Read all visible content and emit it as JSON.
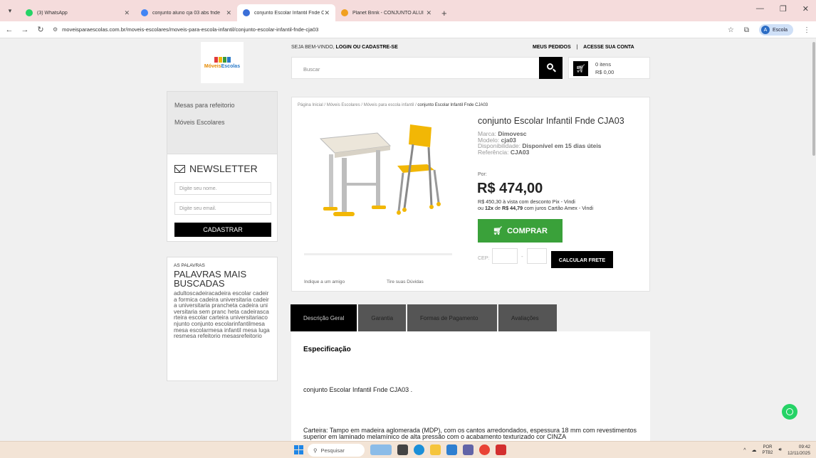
{
  "browser": {
    "tabs": [
      {
        "title": "(3) WhatsApp",
        "color": "#25d366",
        "active": false
      },
      {
        "title": "conjunto aluno cja 03 abs fnde",
        "color": "#4285f4",
        "active": false
      },
      {
        "title": "conjunto Escolar Infantil Fnde C",
        "color": "#3a6fd8",
        "active": true
      },
      {
        "title": "Planet Brink - CONJUNTO ALUI",
        "color": "#f0a020",
        "active": false
      }
    ],
    "new_tab": "+",
    "url": "moveisparaescolas.com.br/moveis-escolares/moveis-para-escola-infantil/conjunto-escolar-infantil-fnde-cja03",
    "profile_label": "Escola",
    "profile_initial": "A"
  },
  "header": {
    "welcome_prefix": "SEJA BEM-VINDO, ",
    "welcome_login": "LOGIN OU CADASTRE-SE",
    "orders": "MEUS PEDIDOS",
    "separator": "|",
    "account": "ACESSE SUA CONTA",
    "search_placeholder": "Buscar",
    "cart_items": "0 itens",
    "cart_total": "R$ 0,00"
  },
  "logo": {
    "brand_a": "Móveis",
    "brand_b": "Escolas"
  },
  "sidebar": {
    "menu": [
      "Mesas para refeitorio",
      "Móveis Escolares"
    ],
    "newsletter_title": "NEWSLETTER",
    "name_placeholder": "Digite seu nome.",
    "email_placeholder": "Digite seu email.",
    "subscribe": "CADASTRAR",
    "words_small": "AS PALAVRAS",
    "words_title": "PALAVRAS MAIS BUSCADAS",
    "words_list": "adultoscadeiracadeira escolar cadeira formica cadeira universitaria cadeira universitaria prancheta cadeira universitaria sem pranc heta cadeirascarteira escolar carteira universitariaconjunto conjunto escolarinfantilmesa mesa escolarmesa infantil mesa lugaresmesa refeitorio mesasrefeitorio"
  },
  "product": {
    "breadcrumb": "Página Inicial / Móveis Escolares / Móveis para escola infantil / ",
    "breadcrumb_current": "conjunto Escolar Infantil Fnde CJA03",
    "title": "conjunto Escolar Infantil Fnde CJA03",
    "brand_label": "Marca:",
    "brand": "Dimovesc",
    "model_label": "Modelo:",
    "model": "cja03",
    "availability_label": "Disponibilidade:",
    "availability": "Disponível em 15 dias úteis",
    "ref_label": "Referência:",
    "ref": "CJA03",
    "price_label": "Por:",
    "price": "R$ 474,00",
    "pix_value": "R$ 450,30",
    "pix_text": " à vista com desconto Pix - Vindi",
    "inst_prefix": "ou ",
    "inst_count": "12x",
    "inst_mid": " de ",
    "inst_value": "R$ 44,79",
    "inst_text": " com juros Cartão Amex - Vindi",
    "buy": "COMPRAR",
    "cep_label": "CEP:",
    "cep_dash": "-",
    "shipping": "CALCULAR FRETE",
    "tell_friend": "Indique a um amigo",
    "questions": "Tire suas Dúvidas"
  },
  "product_tabs": [
    "Descrição Geral",
    "Garantia",
    "Formas de Pagamento",
    "Avaliações"
  ],
  "description": {
    "heading": "Especificação",
    "p1": "conjunto Escolar Infantil Fnde CJA03 .",
    "p2": "Carteira: Tampo em madeira aglomerada (MDP), com os cantos arredondados, espessura 18 mm com revestimentos superior em laminado melamínico de alta pressão com o acabamento texturizado cor CINZA"
  },
  "taskbar": {
    "search": "Pesquisar",
    "lang_1": "POR",
    "lang_2": "PTB2",
    "time": "09:42",
    "date": "12/11/2025"
  },
  "colors": {
    "buy_green": "#3aa13a",
    "tab_bg": "#f5dcdc",
    "chair_yellow": "#f2b705"
  }
}
